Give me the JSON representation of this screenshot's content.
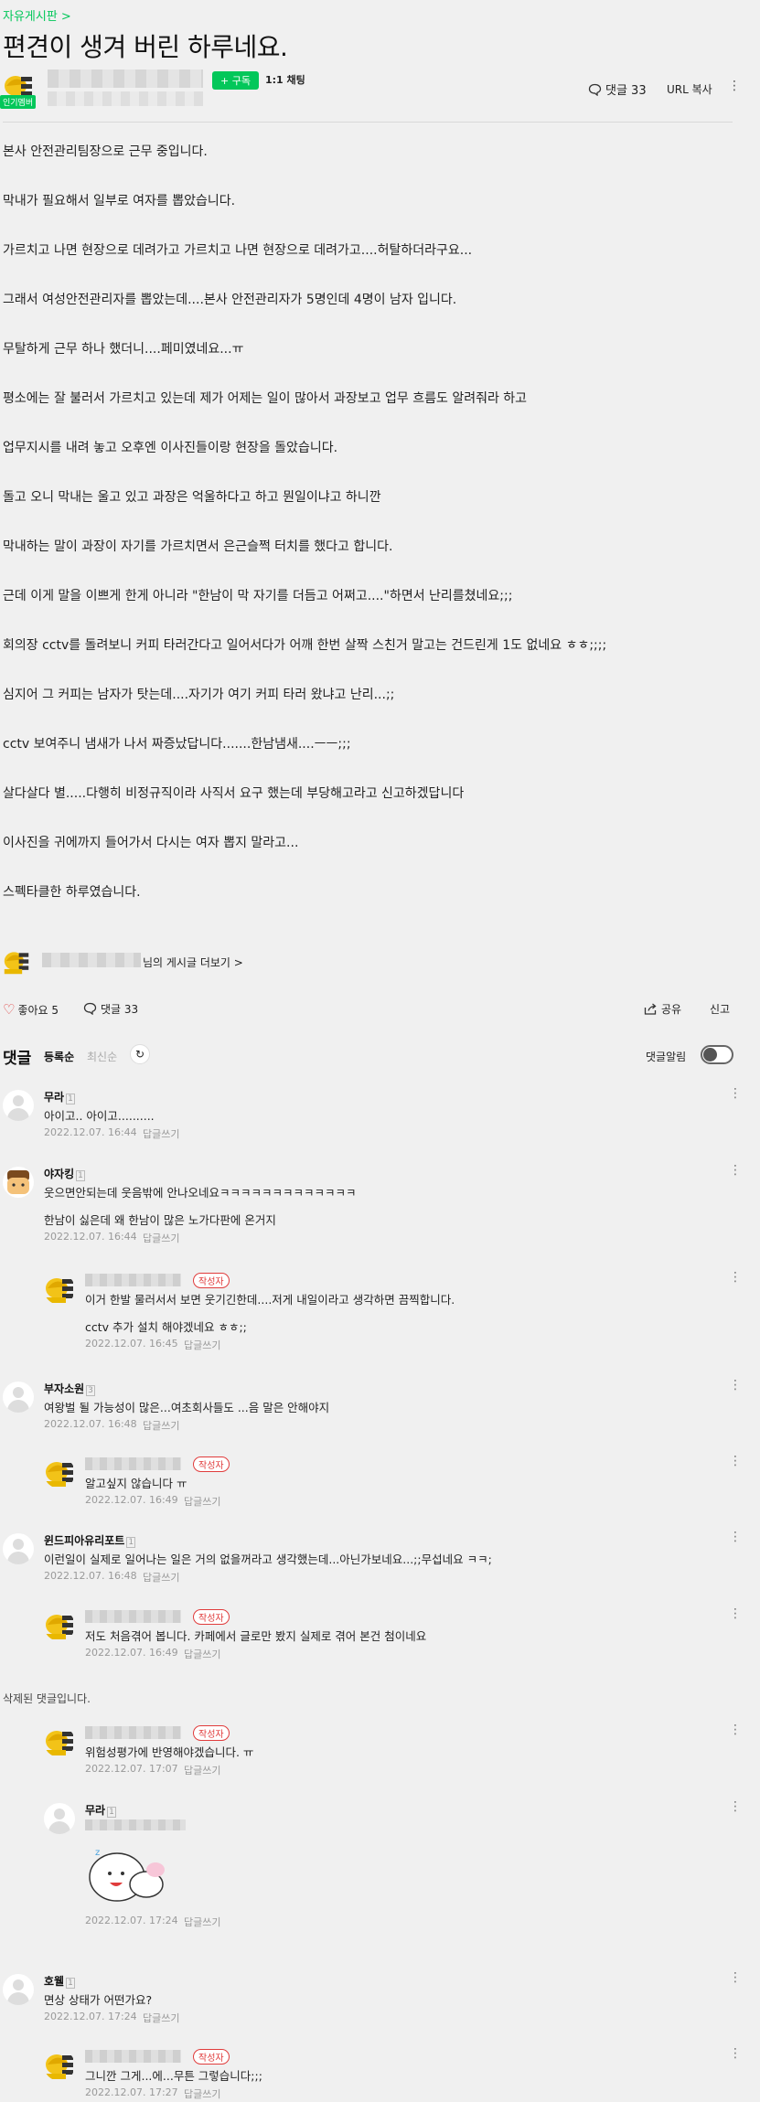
{
  "post": {
    "board": "자유게시판 >",
    "title": "편견이 생겨 버린 하루네요.",
    "popular_badge": "인기멤버",
    "subscribe": "+ 구독",
    "chat": "1:1 채팅",
    "comment_count_label": "댓글 33",
    "url_copy": "URL 복사",
    "more_posts": "님의 게시글 더보기 >",
    "body": [
      "본사 안전관리팀장으로 근무 중입니다.",
      "막내가 필요해서 일부로 여자를 뽑았습니다.",
      "가르치고 나면 현장으로 데려가고 가르치고 나면 현장으로 데려가고....허탈하더라구요...",
      "그래서 여성안전관리자를 뽑았는데....본사 안전관리자가 5명인데 4명이 남자 입니다.",
      "무탈하게 근무 하나 했더니....페미였네요...ㅠ",
      "평소에는 잘 불러서 가르치고 있는데 제가 어제는 일이 많아서 과장보고 업무 흐름도 알려줘라 하고",
      "업무지시를 내려 놓고 오후엔 이사진들이랑 현장을 돌았습니다.",
      "돌고 오니 막내는 울고 있고 과장은 억울하다고 하고 뭔일이냐고 하니깐",
      "막내하는 말이 과장이 자기를 가르치면서 은근슬쩍 터치를 했다고 합니다.",
      "근데 이게 말을 이쁘게 한게 아니라 \"한남이 막 자기를 더듬고 어쩌고....\"하면서 난리를쳤네요;;;",
      "회의장 cctv를 돌려보니 커피 타러간다고 일어서다가 어깨 한번 살짝 스친거 말고는 건드린게 1도 없네요 ㅎㅎ;;;;",
      "심지어 그 커피는 남자가 탓는데....자기가 여기 커피 타러 왔냐고 난리...;;",
      "cctv 보여주니 냄새가 나서 짜증났답니다.......한남냄새....ㅡㅡ;;;",
      "살다살다 별.....다행히 비정규직이라 사직서 요구 했는데 부당해고라고 신고하겠답니다",
      "이사진을 귀에까지 들어가서 다시는 여자 뽑지 말라고...",
      "스펙타클한 하루였습니다."
    ]
  },
  "actions": {
    "like": "좋아요 5",
    "comments": "댓글 33",
    "share": "공유",
    "report": "신고"
  },
  "comments_header": {
    "title": "댓글",
    "sort_registered": "등록순",
    "sort_latest": "최신순",
    "alarm": "댓글알림"
  },
  "labels": {
    "reply": "답글쓰기",
    "writer": "작성자",
    "deleted": "삭제된 댓글입니다."
  },
  "comments": [
    {
      "name": "무라",
      "text": "아이고.. 아이고..........",
      "date": "2022.12.07. 16:44"
    },
    {
      "name": "야자킹",
      "text": "웃으면안되는데 웃음밖에 안나오네요ㅋㅋㅋㅋㅋㅋㅋㅋㅋㅋㅋㅋㅋ",
      "text2": "한남이 싫은데 왜 한남이 많은 노가다판에 온거지",
      "date": "2022.12.07. 16:44"
    },
    {
      "name": "",
      "text": "이거 한발 물러서서 보면 웃기긴한데....저게 내일이라고 생각하면 끔찍합니다.",
      "text2": "cctv 추가 설치 해야겠네요 ㅎㅎ;;",
      "date": "2022.12.07. 16:45"
    },
    {
      "name": "부자소원",
      "text": "여왕벌 될 가능성이 많은...여초회사들도 ...음 말은 안해야지",
      "date": "2022.12.07. 16:48"
    },
    {
      "name": "",
      "text": "알고싶지 않습니다 ㅠ",
      "date": "2022.12.07. 16:49"
    },
    {
      "name": "윈드피아유리포트",
      "text": "이런일이 실제로 일어나는 일은 거의 없을꺼라고 생각했는데...아닌가보네요...;;무섭네요 ㅋㅋ;",
      "date": "2022.12.07. 16:48"
    },
    {
      "name": "",
      "text": "저도 처음겪어 봅니다. 카페에서 글로만 봤지 실제로 겪어 본건 첨이네요",
      "date": "2022.12.07. 16:49"
    },
    {
      "name": "",
      "text": "위험성평가에 반영해야겠습니다. ㅠ",
      "date": "2022.12.07. 17:07"
    },
    {
      "name": "무라",
      "text": "",
      "date": "2022.12.07. 17:24"
    },
    {
      "name": "호웰",
      "text": "면상 상태가 어떤가요?",
      "date": "2022.12.07. 17:24"
    },
    {
      "name": "",
      "text": "그니깐 그게...에...무튼 그렇습니다;;;",
      "date": "2022.12.07. 17:27"
    }
  ]
}
